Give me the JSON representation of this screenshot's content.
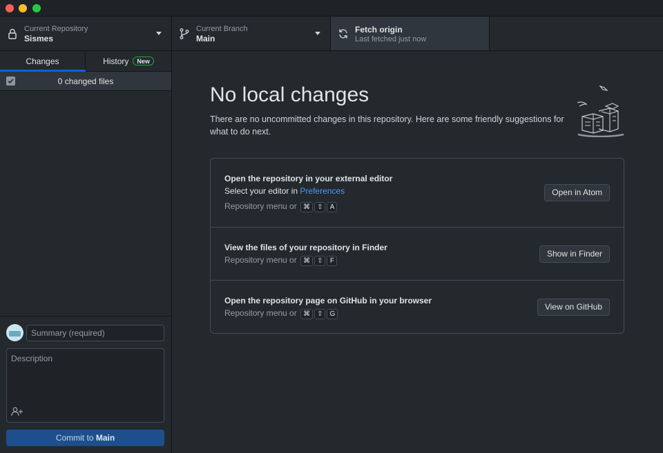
{
  "window": {
    "controls": [
      "close",
      "minimize",
      "zoom"
    ]
  },
  "toolbar": {
    "repository": {
      "label": "Current Repository",
      "value": "Sismes",
      "icon": "lock-icon"
    },
    "branch": {
      "label": "Current Branch",
      "value": "Main",
      "icon": "branch-icon"
    },
    "fetch": {
      "title": "Fetch origin",
      "subtitle": "Last fetched just now",
      "icon": "sync-icon"
    }
  },
  "sidebar": {
    "tabs": {
      "changes": "Changes",
      "history": "History",
      "history_badge": "New"
    },
    "changed_files": {
      "label": "0 changed files",
      "checked": true
    },
    "commit": {
      "summary_placeholder": "Summary (required)",
      "description_placeholder": "Description",
      "button_prefix": "Commit to",
      "button_branch": "Main"
    }
  },
  "main": {
    "title": "No local changes",
    "description": "There are no uncommitted changes in this repository. Here are some friendly suggestions for what to do next.",
    "suggestions": [
      {
        "title": "Open the repository in your external editor",
        "line_prefix": "Select your editor in",
        "line_link": "Preferences",
        "shortcut_prefix": "Repository menu or",
        "keys": [
          "⌘",
          "⇧",
          "A"
        ],
        "button": "Open in Atom"
      },
      {
        "title": "View the files of your repository in Finder",
        "shortcut_prefix": "Repository menu or",
        "keys": [
          "⌘",
          "⇧",
          "F"
        ],
        "button": "Show in Finder"
      },
      {
        "title": "Open the repository page on GitHub in your browser",
        "shortcut_prefix": "Repository menu or",
        "keys": [
          "⌘",
          "⇧",
          "G"
        ],
        "button": "View on GitHub"
      }
    ]
  },
  "colors": {
    "accent": "#0366d6",
    "link": "#4d9bf5",
    "commit_button": "#1d4f8c",
    "badge_border": "#28a745"
  }
}
